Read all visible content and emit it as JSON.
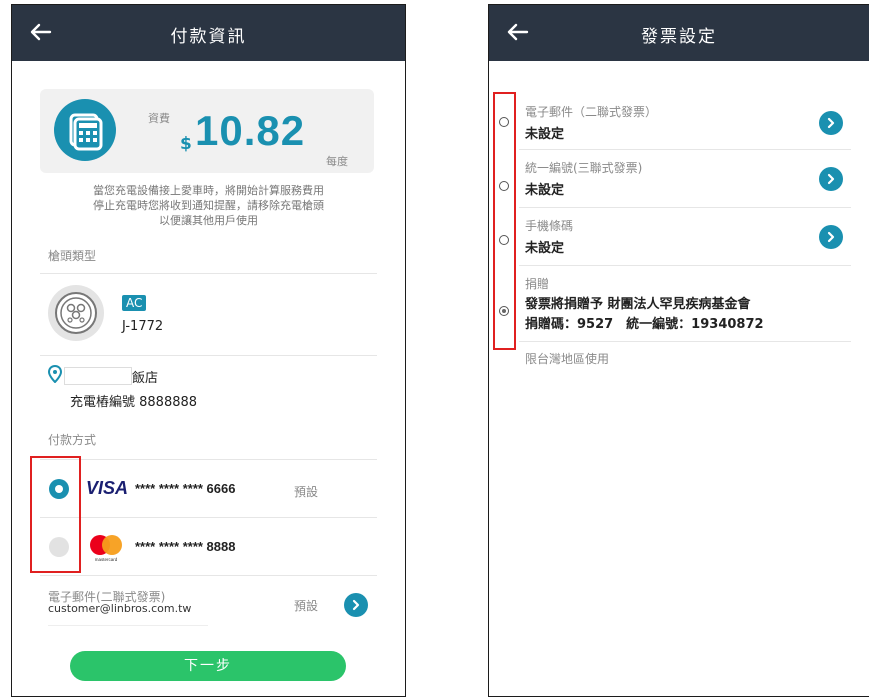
{
  "left": {
    "header": {
      "title": "付款資訊"
    },
    "fee": {
      "label": "資費",
      "currency": "$",
      "amount": "10.82",
      "unit": "每度"
    },
    "notice": {
      "line1": "當您充電設備接上愛車時，將開始計算服務費用",
      "line2": "停止充電時您將收到通知提醒，請移除充電槍頭",
      "line3": "以便讓其他用戶使用"
    },
    "connector": {
      "section_label": "槍頭類型",
      "badge": "AC",
      "type": "J-1772"
    },
    "location": {
      "name": "飯店",
      "charger_label": "充電樁編號 8888888"
    },
    "payment": {
      "section_label": "付款方式",
      "cards": [
        {
          "brand": "VISA",
          "number": "**** **** **** 6666",
          "tag": "預設",
          "selected": true
        },
        {
          "brand": "mastercard",
          "number": "**** **** **** 8888",
          "tag": "",
          "selected": false
        }
      ]
    },
    "invoice": {
      "label": "電子郵件(二聯式發票)",
      "email": "customer@linbros.com.tw",
      "tag": "預設"
    },
    "next_button": "下一步"
  },
  "right": {
    "header": {
      "title": "發票設定"
    },
    "options": [
      {
        "label": "電子郵件（二聯式發票）",
        "value": "未設定",
        "selected": false
      },
      {
        "label": "統一編號(三聯式發票)",
        "value": "未設定",
        "selected": false
      },
      {
        "label": "手機條碼",
        "value": "未設定",
        "selected": false
      }
    ],
    "donation": {
      "label": "捐贈",
      "line1": "發票將捐贈予 財團法人罕見疾病基金會",
      "line2": "捐贈碼：9527　統一編號：19340872",
      "selected": true
    },
    "footnote": "限台灣地區使用"
  },
  "colors": {
    "header_bg": "#2b3543",
    "accent": "#1a90b0",
    "button_green": "#2bc46a",
    "highlight_red": "#e02020",
    "visa_blue": "#1a1f71"
  }
}
